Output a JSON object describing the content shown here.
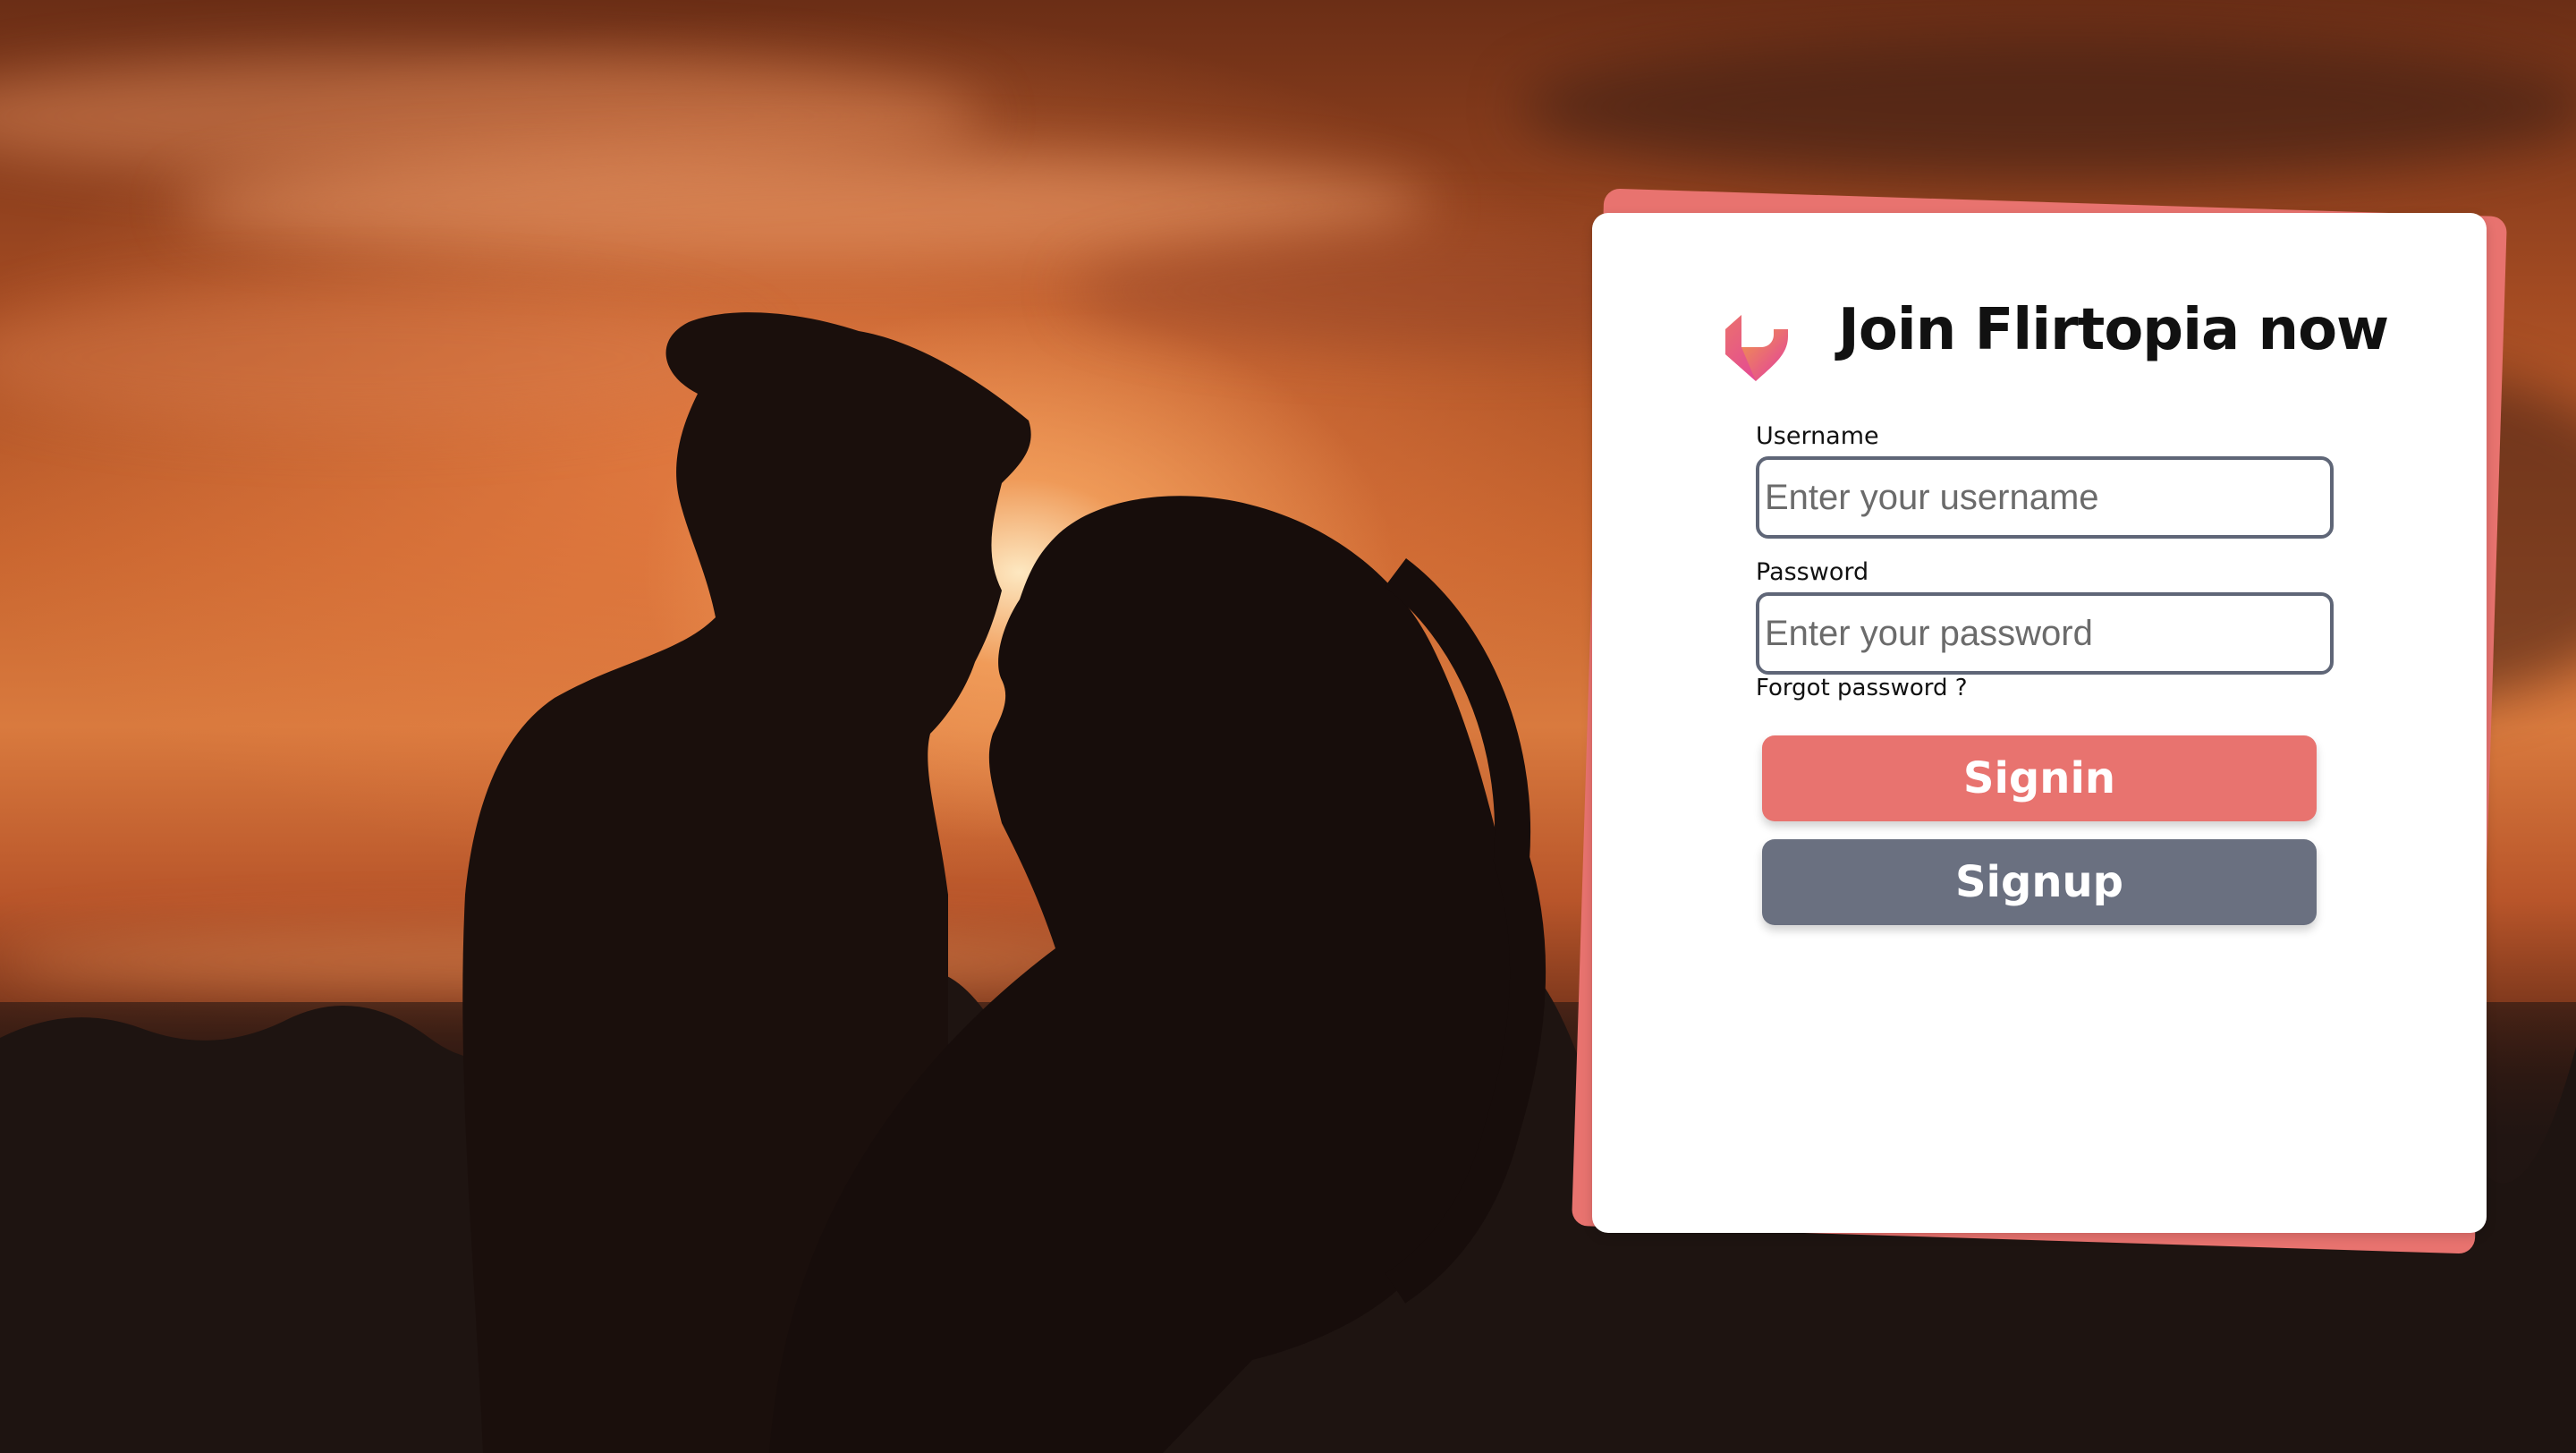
{
  "brand": {
    "logo_icon": "heart-logo-icon",
    "title": "Join Flirtopia now"
  },
  "form": {
    "username": {
      "label": "Username",
      "placeholder": "Enter your username",
      "value": ""
    },
    "password": {
      "label": "Password",
      "placeholder": "Enter your password",
      "value": ""
    },
    "forgot_password": "Forgot password ?",
    "signin_label": "Signin",
    "signup_label": "Signup"
  },
  "colors": {
    "accent": "#e8736f",
    "secondary": "#6a7080",
    "input_border": "#5f6677",
    "card_background": "#ffffff",
    "logo_gradient_start": "#f5b52e",
    "logo_gradient_end": "#e23aa3"
  },
  "background": {
    "description_icon": "sunset-couple-photo"
  }
}
